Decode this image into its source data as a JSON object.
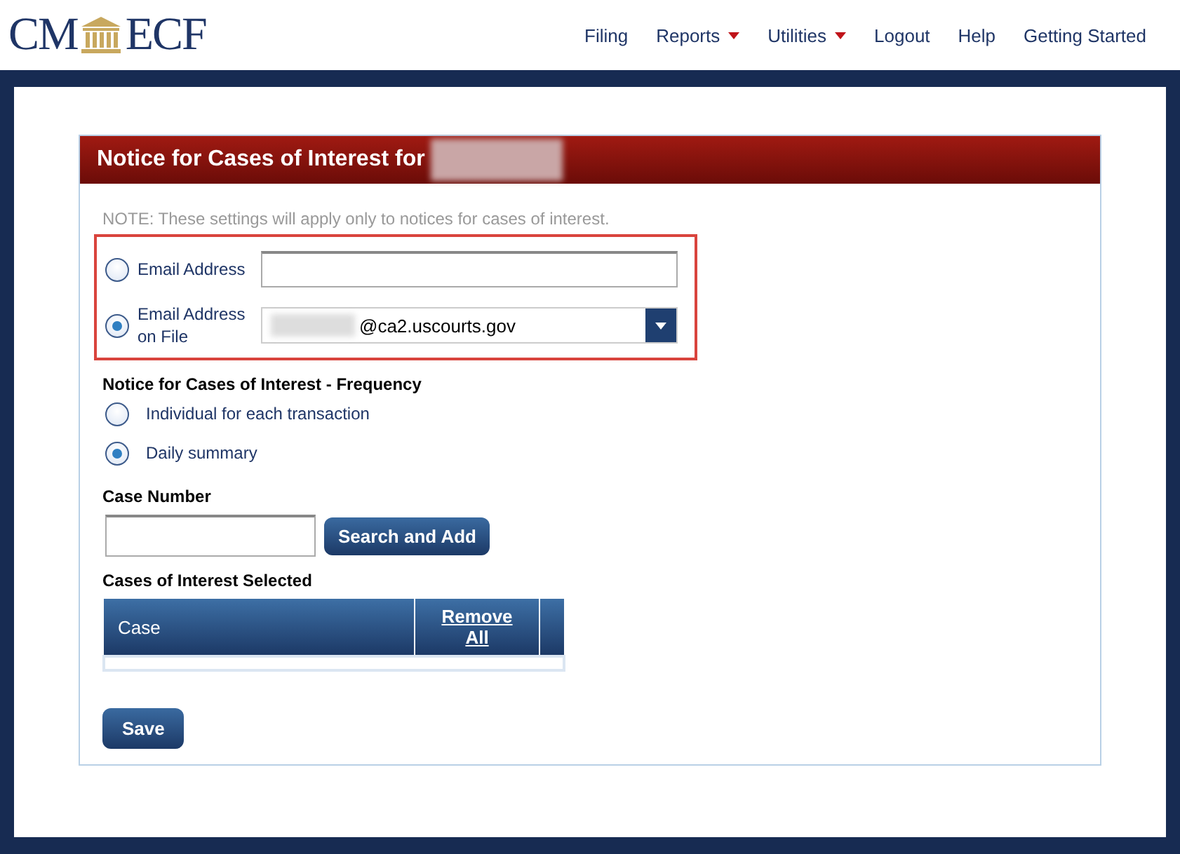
{
  "header": {
    "logo_left": "CM",
    "logo_right": "ECF",
    "nav": [
      {
        "label": "Filing",
        "has_menu": false
      },
      {
        "label": "Reports",
        "has_menu": true
      },
      {
        "label": "Utilities",
        "has_menu": true
      },
      {
        "label": "Logout",
        "has_menu": false
      },
      {
        "label": "Help",
        "has_menu": false
      },
      {
        "label": "Getting Started",
        "has_menu": false
      }
    ]
  },
  "panel": {
    "title": "Notice for Cases of Interest for",
    "note": "NOTE: These settings will apply only to notices for cases of interest.",
    "email_options": [
      {
        "label": "Email Address",
        "selected": false,
        "kind": "text"
      },
      {
        "label": "Email Address on File",
        "selected": true,
        "kind": "select",
        "value": "@ca2.uscourts.gov"
      }
    ],
    "frequency": {
      "heading": "Notice for Cases of Interest - Frequency",
      "options": [
        {
          "label": "Individual for each transaction",
          "selected": false
        },
        {
          "label": "Daily summary",
          "selected": true
        }
      ]
    },
    "case_number": {
      "label": "Case Number",
      "button": "Search and Add"
    },
    "selected_cases": {
      "heading": "Cases of Interest Selected",
      "columns": [
        {
          "label": "Case",
          "kind": "text"
        },
        {
          "label": "Remove All",
          "kind": "link"
        }
      ]
    },
    "save": "Save"
  }
}
